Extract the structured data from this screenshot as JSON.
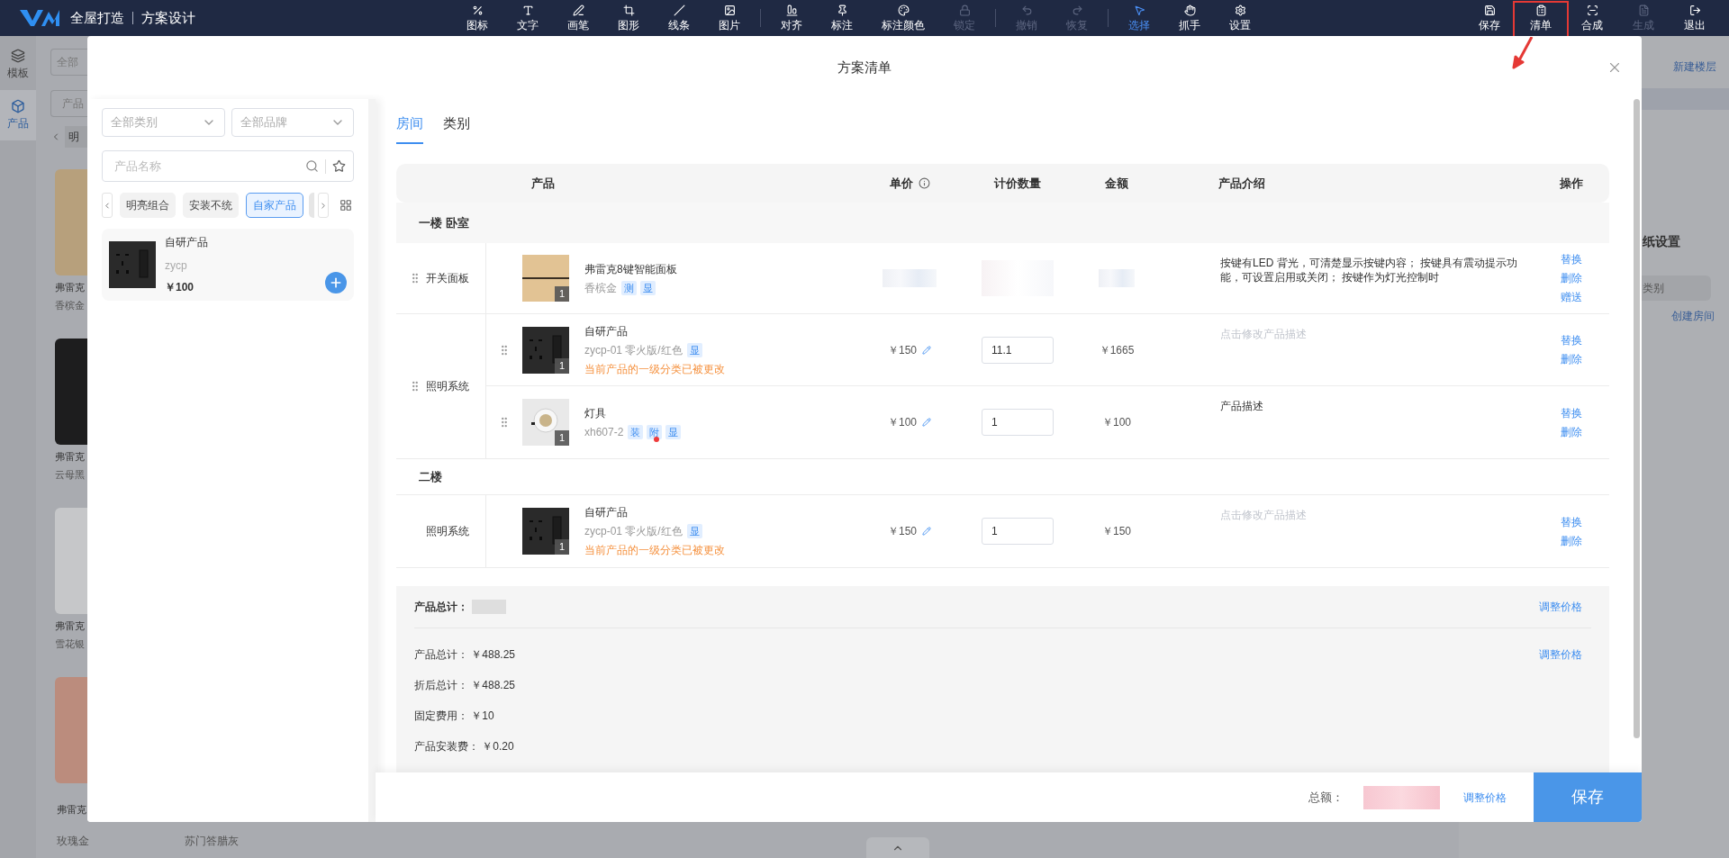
{
  "topbar": {
    "brand": "全屋打造",
    "section": "方案设计",
    "tool_groups": [
      [
        {
          "label": "图标",
          "disabled": false,
          "selected": false
        },
        {
          "label": "文字",
          "disabled": false,
          "selected": false
        },
        {
          "label": "画笔",
          "disabled": false,
          "selected": false
        },
        {
          "label": "图形",
          "disabled": false,
          "selected": false
        },
        {
          "label": "线条",
          "disabled": false,
          "selected": false
        },
        {
          "label": "图片",
          "disabled": false,
          "selected": false
        }
      ],
      [
        {
          "label": "对齐",
          "disabled": false,
          "selected": false
        },
        {
          "label": "标注",
          "disabled": false,
          "selected": false
        },
        {
          "label": "标注颜色",
          "disabled": false,
          "selected": false
        },
        {
          "label": "锁定",
          "disabled": true,
          "selected": false
        }
      ],
      [
        {
          "label": "撤销",
          "disabled": true,
          "selected": false
        },
        {
          "label": "恢复",
          "disabled": true,
          "selected": false
        }
      ],
      [
        {
          "label": "选择",
          "disabled": false,
          "selected": true
        },
        {
          "label": "抓手",
          "disabled": false,
          "selected": false
        },
        {
          "label": "设置",
          "disabled": false,
          "selected": false
        }
      ]
    ],
    "actions": [
      {
        "label": "保存",
        "disabled": false,
        "annotated": false
      },
      {
        "label": "清单",
        "disabled": false,
        "annotated": true
      },
      {
        "label": "合成",
        "disabled": false,
        "annotated": false
      },
      {
        "label": "生成",
        "disabled": true,
        "annotated": false
      },
      {
        "label": "退出",
        "disabled": false,
        "annotated": false
      }
    ]
  },
  "background": {
    "nav": [
      {
        "label": "模板",
        "selected": false
      },
      {
        "label": "产品",
        "selected": true
      }
    ],
    "filter_select": "全部",
    "search_placeholder": "产品",
    "chip": "明",
    "cards": [
      {
        "name": "弗雷克",
        "variant": "香槟金",
        "color": "#b7a07c"
      },
      {
        "name": "弗雷克",
        "variant": "云母黑",
        "color": "#1d1d1e"
      },
      {
        "name": "弗雷克",
        "variant": "雪花银",
        "color": "#c6c7c9"
      },
      {
        "name": "弗雷克",
        "variant": "玫瑰金",
        "color": "#bb8c7d"
      }
    ],
    "second_column_variant": "苏门答腊灰",
    "right_panel": {
      "new_floor": "新建楼层",
      "drawing_settings": "纸设置",
      "category_placeholder": "类别",
      "create_room": "创建房间"
    }
  },
  "modal": {
    "title": "方案清单",
    "catalog": {
      "category_select": "全部类别",
      "brand_select": "全部品牌",
      "search_placeholder": "产品名称",
      "chips": [
        {
          "label": "明亮组合",
          "selected": false
        },
        {
          "label": "安装不统",
          "selected": false
        },
        {
          "label": "自家产品",
          "selected": true
        }
      ],
      "products": [
        {
          "name": "自研产品",
          "code": "zycp",
          "price": "￥100",
          "kind": "socket"
        }
      ]
    },
    "tabs": [
      {
        "label": "房间",
        "selected": true
      },
      {
        "label": "类别",
        "selected": false
      }
    ],
    "columns": [
      "产品",
      "单价",
      "计价数量",
      "金额",
      "产品介绍",
      "操作"
    ],
    "floors": [
      {
        "name": "一楼 卧室",
        "groups": [
          {
            "category": "开关面板",
            "draggable": true,
            "items": [
              {
                "draggable": false,
                "kind": "gold-panel",
                "count": "1",
                "name": "弗雷克8键智能面板",
                "spec": "香槟金",
                "tags": [
                  {
                    "label": "测",
                    "alert": false
                  },
                  {
                    "label": "显",
                    "alert": false
                  }
                ],
                "description": "按键有LED 背光，可清楚显示按键内容； 按键具有震动提示功能，可设置启用或关闭； 按键作为灯光控制时",
                "actions": [
                  "替换",
                  "删除",
                  "赠送"
                ]
              }
            ]
          },
          {
            "category": "照明系统",
            "draggable": true,
            "items": [
              {
                "draggable": true,
                "kind": "socket",
                "count": "1",
                "name": "自研产品",
                "spec": "zycp-01 零火版/红色",
                "tags": [
                  {
                    "label": "显",
                    "alert": false
                  }
                ],
                "warning": "当前产品的一级分类已被更改",
                "price": "￥150",
                "quantity": "11.1",
                "amount": "￥1665",
                "description_placeholder": "点击修改产品描述",
                "actions": [
                  "替换",
                  "删除"
                ]
              },
              {
                "draggable": true,
                "kind": "lamp",
                "count": "1",
                "name": "灯具",
                "spec": "xh607-2",
                "tags": [
                  {
                    "label": "装",
                    "alert": false
                  },
                  {
                    "label": "附",
                    "alert": true
                  },
                  {
                    "label": "显",
                    "alert": false
                  }
                ],
                "price": "￥100",
                "quantity": "1",
                "amount": "￥100",
                "description": "产品描述",
                "actions": [
                  "替换",
                  "删除"
                ]
              }
            ]
          }
        ]
      },
      {
        "name": "二楼",
        "groups": [
          {
            "category": "照明系统",
            "draggable": false,
            "items": [
              {
                "draggable": false,
                "kind": "socket",
                "count": "1",
                "name": "自研产品",
                "spec": "zycp-01 零火版/红色",
                "tags": [
                  {
                    "label": "显",
                    "alert": false
                  }
                ],
                "warning": "当前产品的一级分类已被更改",
                "price": "￥150",
                "quantity": "1",
                "amount": "￥150",
                "description_placeholder": "点击修改产品描述",
                "actions": [
                  "替换",
                  "删除"
                ]
              }
            ]
          }
        ]
      }
    ],
    "summary": {
      "heading": "产品总计：",
      "heading_action": "调整价格",
      "lines": [
        {
          "label": "产品总计：",
          "value": "￥488.25",
          "action": "调整价格"
        },
        {
          "label": "折后总计：",
          "value": "￥488.25"
        },
        {
          "label": "固定费用：",
          "value": "￥10"
        },
        {
          "label": "产品安装费：",
          "value": "￥0.20"
        }
      ]
    },
    "footer": {
      "total_label": "总额：",
      "adjust": "调整价格",
      "save": "保存"
    }
  }
}
